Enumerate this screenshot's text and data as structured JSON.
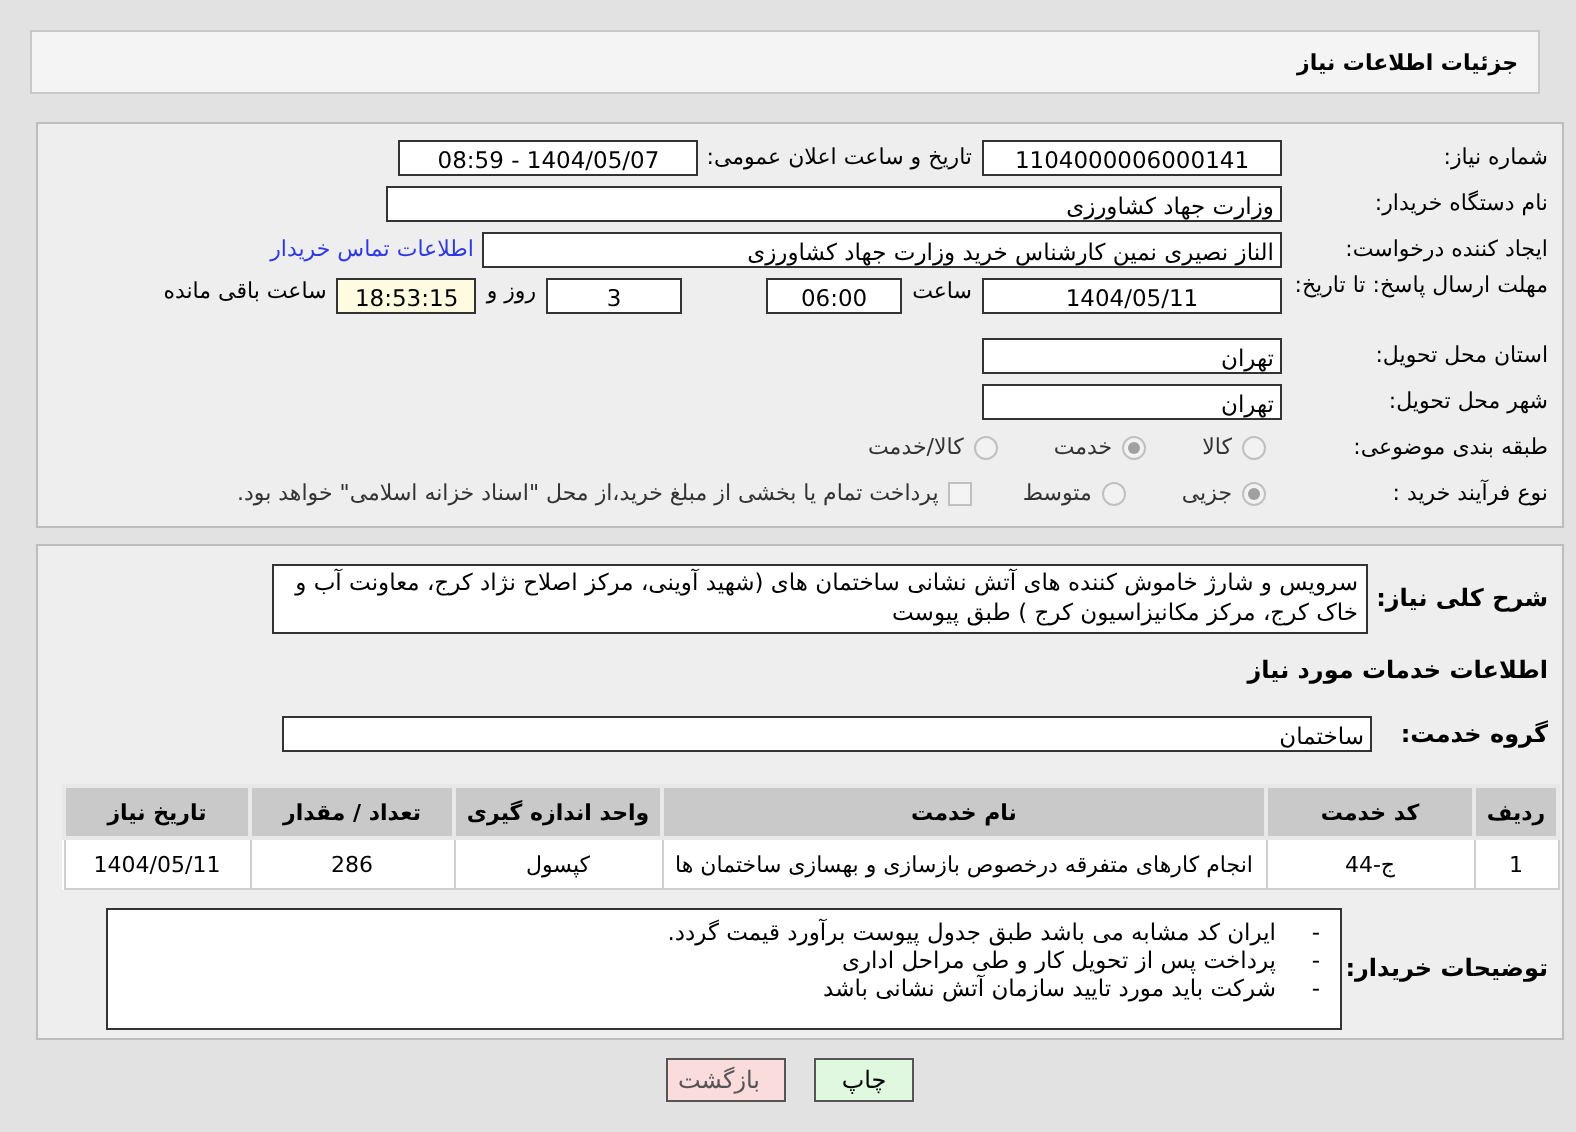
{
  "header": {
    "title": "جزئیات اطلاعات نیاز"
  },
  "details": {
    "need_number": {
      "label": "شماره نیاز:",
      "value": "1104000006000141"
    },
    "announce": {
      "label": "تاریخ و ساعت اعلان عمومی:",
      "value": "1404/05/07 - 08:59"
    },
    "buyer_org": {
      "label": "نام دستگاه خریدار:",
      "value": "وزارت جهاد کشاورزی"
    },
    "requester": {
      "label": "ایجاد کننده درخواست:",
      "value": "الناز نصیری نمین کارشناس خرید وزارت جهاد کشاورزی",
      "link": "اطلاعات تماس خریدار"
    },
    "deadline": {
      "label": "مهلت ارسال پاسخ: تا تاریخ:",
      "date": "1404/05/11",
      "time_label": "ساعت",
      "time": "06:00",
      "days": "3",
      "days_label": "روز و",
      "remaining": "18:53:15",
      "remaining_label": "ساعت باقی مانده"
    },
    "province": {
      "label": "استان محل تحویل:",
      "value": "تهران"
    },
    "city": {
      "label": "شهر محل تحویل:",
      "value": "تهران"
    },
    "category": {
      "label": "طبقه بندی موضوعی:",
      "options": [
        {
          "label": "کالا",
          "selected": false
        },
        {
          "label": "خدمت",
          "selected": true
        },
        {
          "label": "کالا/خدمت",
          "selected": false
        }
      ]
    },
    "process": {
      "label": "نوع فرآیند خرید :",
      "options": [
        {
          "label": "جزیی",
          "selected": true
        },
        {
          "label": "متوسط",
          "selected": false
        }
      ],
      "payment": {
        "label": "پرداخت تمام یا بخشی از مبلغ خرید،از محل \"اسناد خزانه اسلامی\" خواهد بود.",
        "checked": false
      }
    }
  },
  "description": {
    "label": "شرح کلی نیاز:",
    "value": "سرویس و شارژ خاموش کننده های آتش نشانی ساختمان های (شهید آوینی، مرکز اصلاح نژاد کرج، معاونت آب و خاک کرج، مرکز مکانیزاسیون کرج ) طبق پیوست"
  },
  "services_title": "اطلاعات خدمات مورد نیاز",
  "service_group": {
    "label": "گروه خدمت:",
    "value": "ساختمان"
  },
  "table": {
    "columns": [
      "ردیف",
      "کد خدمت",
      "نام خدمت",
      "واحد اندازه گیری",
      "تعداد / مقدار",
      "تاریخ نیاز"
    ],
    "rows": [
      [
        "1",
        "ج-44",
        "انجام کارهای متفرقه درخصوص بازسازی و بهسازی ساختمان ها",
        "کپسول",
        "286",
        "1404/05/11"
      ]
    ]
  },
  "buyer_notes": {
    "label": "توضیحات خریدار:",
    "lines": [
      {
        "bullet": "-",
        "text": "ایران کد مشابه می باشد طبق جدول پیوست برآورد قیمت گردد."
      },
      {
        "bullet": "-",
        "text": "پرداخت پس از تحویل کار و طی مراحل اداری"
      },
      {
        "bullet": "-",
        "text": "شرکت باید مورد تایید سازمان آتش نشانی باشد"
      }
    ]
  },
  "buttons": [
    {
      "label": "چاپ",
      "kind": "print"
    },
    {
      "label": "بازگشت",
      "kind": "back"
    }
  ]
}
